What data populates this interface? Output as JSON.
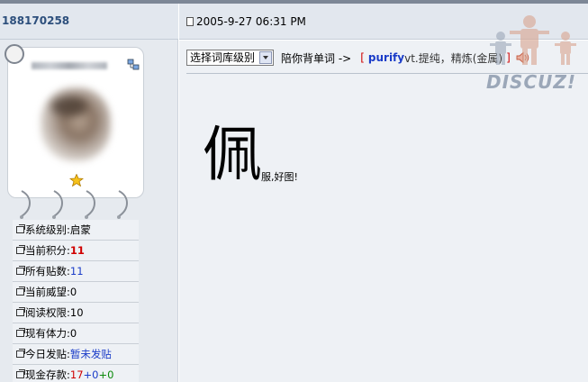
{
  "user": {
    "id": "188170258"
  },
  "post": {
    "date": "2005-9-27 06:31 PM",
    "big_char": "佩",
    "small_text": "服,好图!"
  },
  "toolbar": {
    "level_select": "选择词库级别",
    "recite_label": "陪你背单词 ->",
    "bracket_open": "[",
    "word": "purify",
    "definition": " vt.提纯，精炼(金属)",
    "bracket_close": "]"
  },
  "stats": [
    {
      "label": "系统级别:",
      "value": "启蒙"
    },
    {
      "label": "当前积分:",
      "value": "11"
    },
    {
      "label": "所有贴数:",
      "value": "11"
    },
    {
      "label": "当前威望:",
      "value": "0"
    },
    {
      "label": "阅读权限:",
      "value": "10"
    },
    {
      "label": "现有体力:",
      "value": "0"
    },
    {
      "label": "今日发贴:",
      "value": "暂未发贴"
    },
    {
      "label": "现金存款:",
      "value_a": "17",
      "value_b": "+0",
      "value_c": " +0"
    }
  ],
  "watermark": {
    "text": "DISCUZ!"
  },
  "colors": {
    "accent_blue": "#1a3cc8",
    "accent_red": "#d00000",
    "accent_green": "#0a8a0a",
    "header_bg": "#e2e7ee"
  },
  "icons": [
    "doc-icon",
    "network-icon",
    "star-icon",
    "speaker-icon",
    "stat-icon",
    "discuz-logo"
  ]
}
